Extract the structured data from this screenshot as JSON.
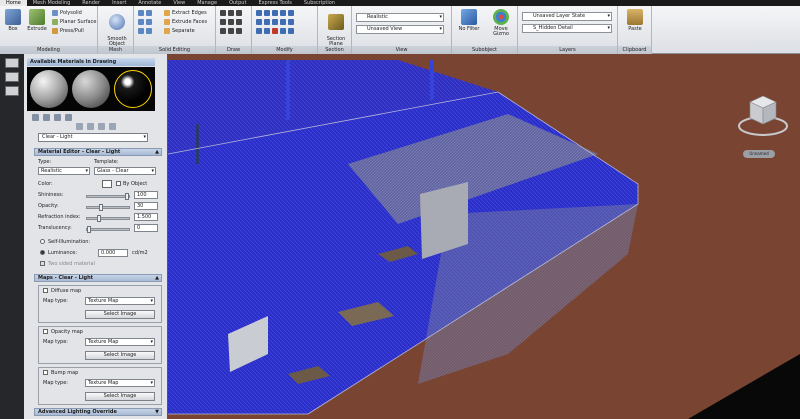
{
  "ribbon": {
    "tabs": [
      "Home",
      "Mesh Modeling",
      "Render",
      "Insert",
      "Annotate",
      "View",
      "Manage",
      "Output",
      "Express Tools",
      "Subscription"
    ],
    "modeling": {
      "title": "Modeling",
      "box": "Box",
      "extrude": "Extrude",
      "polysolid": "Polysolid",
      "planar_surface": "Planar Surface",
      "presspull": "Press/Pull"
    },
    "mesh": {
      "title": "Mesh",
      "smooth_object": "Smooth\nObject"
    },
    "solid_editing": {
      "title": "Solid Editing",
      "extract_edges": "Extract Edges",
      "extrude_faces": "Extrude Faces",
      "separate": "Separate"
    },
    "draw": {
      "title": "Draw"
    },
    "modify": {
      "title": "Modify"
    },
    "section": {
      "title": "Section",
      "section_plane": "Section\nPlane"
    },
    "view": {
      "title": "View",
      "visual_style": "Realistic",
      "named_view": "Unsaved View"
    },
    "subobject": {
      "title": "Subobject",
      "no_filter": "No Filter",
      "move_gizmo": "Move Gizmo"
    },
    "layers": {
      "title": "Layers",
      "layer_state": "Unsaved Layer State",
      "current_layer": "S_Hidden Detail"
    },
    "clipboard": {
      "title": "Clipboard",
      "paste": "Paste"
    }
  },
  "palette": {
    "available_title": "Available Materials in Drawing",
    "material_name": "Clear - Light",
    "editor_title": "Material Editor - Clear - Light",
    "type_label": "Type:",
    "type_value": "Realistic",
    "template_label": "Template:",
    "template_value": "Glass - Clear",
    "color_label": "Color:",
    "by_object": "By Object",
    "shininess_label": "Shininess:",
    "shininess_value": "100",
    "opacity_label": "Opacity:",
    "opacity_value": "30",
    "refraction_label": "Refraction index:",
    "refraction_value": "1.500",
    "translucency_label": "Translucency:",
    "translucency_value": "0",
    "self_illumination": "Self-Illumination:",
    "luminance_label": "Luminance:",
    "luminance_value": "0.000",
    "luminance_unit": "cd/m2",
    "two_sided": "Two sided material",
    "maps_title": "Maps - Clear - Light",
    "diffuse_map": "Diffuse map",
    "opacity_map": "Opacity map",
    "bump_map": "Bump map",
    "map_type_label": "Map type:",
    "map_type_value": "Texture Map",
    "select_image": "Select Image",
    "advanced_title": "Advanced Lighting Override"
  },
  "viewport": {
    "wcs_label": "Unnamed"
  },
  "colors": {
    "floor": "#7a4432",
    "glass": "#2a2ec8",
    "ribbon_bg": "#e6e8ec",
    "panel_bg": "#e2e4e8"
  }
}
